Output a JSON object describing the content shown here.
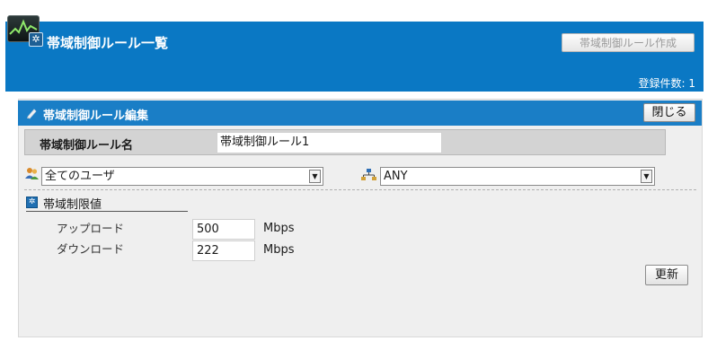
{
  "header": {
    "title": "帯域制御ルール一覧",
    "create_button": "帯域制御ルール作成",
    "count_label": "登録件数: 1"
  },
  "panel": {
    "title": "帯域制御ルール編集",
    "close_button": "閉じる",
    "name_label": "帯域制御ルール名",
    "name_value": "帯域制御ルール1",
    "user_select_value": "全てのユーザ",
    "network_select_value": "ANY",
    "limit_section_label": "帯域制限値",
    "upload_label": "アップロード",
    "upload_value": "500",
    "upload_unit": "Mbps",
    "download_label": "ダウンロード",
    "download_value": "222",
    "download_unit": "Mbps",
    "update_button": "更新"
  },
  "colors": {
    "header_blue": "#0a78c4",
    "panel_header_blue": "#1a7ec6",
    "panel_bg": "#efefef"
  },
  "icons": [
    "app-logo-icon",
    "settings-icon",
    "pencil-icon",
    "users-icon",
    "network-icon",
    "bandwidth-limit-icon",
    "dropdown-arrow-icon"
  ]
}
